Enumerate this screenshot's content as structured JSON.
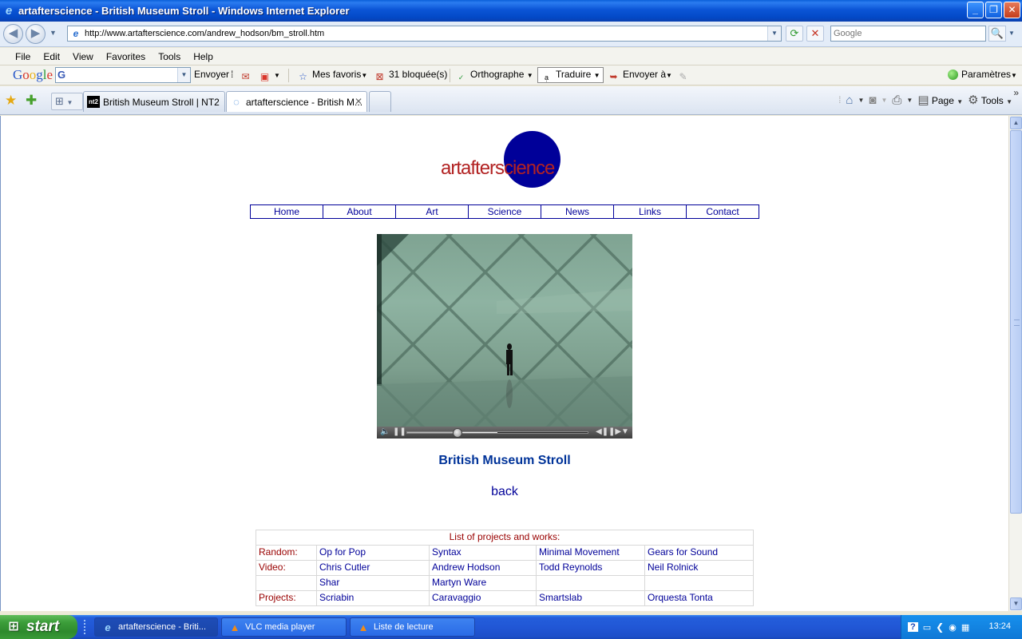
{
  "window": {
    "title": "artafterscience - British Museum Stroll - Windows Internet Explorer",
    "icon": "ie-icon"
  },
  "address": {
    "url": "http://www.artafterscience.com/andrew_hodson/bm_stroll.htm",
    "search_placeholder": "Google"
  },
  "menu": [
    "File",
    "Edit",
    "View",
    "Favorites",
    "Tools",
    "Help"
  ],
  "google_toolbar": {
    "send": "Envoyer",
    "favorites": "Mes favoris",
    "blocked": "31 bloquée(s)",
    "spelling": "Orthographe",
    "translate": "Traduire",
    "send_to": "Envoyer à",
    "settings": "Paramètres"
  },
  "tabs": [
    {
      "label": "British Museum Stroll | NT2",
      "icon_text": "nt2"
    },
    {
      "label": "artafterscience - British M...",
      "active": true
    }
  ],
  "command_bar": {
    "page": "Page",
    "tools": "Tools"
  },
  "site": {
    "logo_text": "artafterscience",
    "nav": [
      "Home",
      "About",
      "Art",
      "Science",
      "News",
      "Links",
      "Contact"
    ],
    "caption": "British Museum Stroll",
    "back": "back",
    "video_progress": 0.28,
    "video_loaded": 0.5
  },
  "projects": {
    "header": "List of projects and works:",
    "rows": [
      {
        "category": "Random:",
        "items": [
          "Op for Pop",
          "Syntax",
          "Minimal Movement",
          "Gears for Sound"
        ]
      },
      {
        "category": "Video:",
        "items": [
          "Chris Cutler",
          "Andrew Hodson",
          "Todd Reynolds",
          "Neil Rolnick"
        ]
      },
      {
        "category": "",
        "items": [
          "Shar",
          "Martyn Ware",
          "",
          ""
        ]
      },
      {
        "category": "Projects:",
        "items": [
          "Scriabin",
          "Caravaggio",
          "Smartslab",
          "Orquesta Tonta"
        ]
      }
    ]
  },
  "taskbar": {
    "start": "start",
    "items": [
      {
        "label": "artafterscience - Briti...",
        "icon": "ie-icon",
        "active": true
      },
      {
        "label": "VLC media player",
        "icon": "vlc-icon"
      },
      {
        "label": "Liste de lecture",
        "icon": "vlc-icon"
      }
    ],
    "clock": "13:24"
  }
}
